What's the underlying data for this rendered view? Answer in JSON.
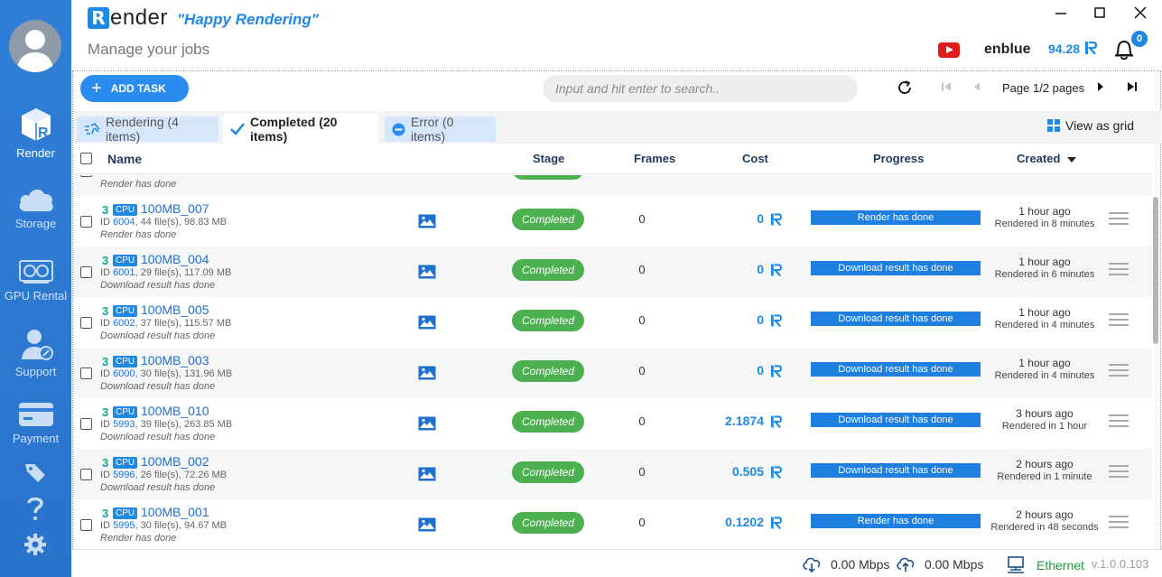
{
  "app": {
    "logo_letter": "R",
    "logo_text": "ender",
    "slogan": "\"Happy Rendering\"",
    "subtitle": "Manage your jobs"
  },
  "sidebar": {
    "items": [
      {
        "label": "Render",
        "icon": "render-cube-icon",
        "active": true
      },
      {
        "label": "Storage",
        "icon": "cloud-icon"
      },
      {
        "label": "GPU Rental",
        "icon": "gpu-card-icon"
      },
      {
        "label": "Support",
        "icon": "support-agent-icon"
      },
      {
        "label": "Payment",
        "icon": "credit-card-icon"
      }
    ],
    "bottom_icons": [
      "tag-icon",
      "help-icon",
      "gear-icon"
    ]
  },
  "user": {
    "name": "enblue",
    "balance": "94.28",
    "notifications": "0"
  },
  "toolbar": {
    "add_task_label": "ADD TASK",
    "search_placeholder": "Input and hit enter to search..",
    "page_label": "Page 1/2 pages"
  },
  "tabs": {
    "rendering": "Rendering (4 items)",
    "completed": "Completed (20 items)",
    "error": "Error (0 items)",
    "view_as_grid": "View as grid"
  },
  "table": {
    "columns": {
      "name": "Name",
      "stage": "Stage",
      "frames": "Frames",
      "cost": "Cost",
      "progress": "Progress",
      "created": "Created"
    },
    "partial_row_status": "Render has done",
    "rows": [
      {
        "cpu": "3",
        "tag": "CPU",
        "name": "100MB_007",
        "id": "6004",
        "meta": ", 44 file(s), 98.83 MB",
        "status": "Render has done",
        "stage": "Completed",
        "frames": "0",
        "cost": "0",
        "progress": "Render has done",
        "created": "1 hour ago",
        "rendered": "Rendered in 8 minutes"
      },
      {
        "cpu": "3",
        "tag": "CPU",
        "name": "100MB_004",
        "id": "6001",
        "meta": ", 29 file(s), 117.09 MB",
        "status": "Download result has done",
        "stage": "Completed",
        "frames": "0",
        "cost": "0",
        "progress": "Download result has done",
        "created": "1 hour ago",
        "rendered": "Rendered in 6 minutes"
      },
      {
        "cpu": "3",
        "tag": "CPU",
        "name": "100MB_005",
        "id": "6002",
        "meta": ", 37 file(s), 115.57 MB",
        "status": "Download result has done",
        "stage": "Completed",
        "frames": "0",
        "cost": "0",
        "progress": "Download result has done",
        "created": "1 hour ago",
        "rendered": "Rendered in 4 minutes"
      },
      {
        "cpu": "3",
        "tag": "CPU",
        "name": "100MB_003",
        "id": "6000",
        "meta": ", 30 file(s), 131.96 MB",
        "status": "Download result has done",
        "stage": "Completed",
        "frames": "0",
        "cost": "0",
        "progress": "Download result has done",
        "created": "1 hour ago",
        "rendered": "Rendered in 4 minutes"
      },
      {
        "cpu": "3",
        "tag": "CPU",
        "name": "100MB_010",
        "id": "5993",
        "meta": ", 39 file(s), 263.85 MB",
        "status": "Download result has done",
        "stage": "Completed",
        "frames": "0",
        "cost": "2.1874",
        "progress": "Download result has done",
        "created": "3 hours ago",
        "rendered": "Rendered in 1 hour"
      },
      {
        "cpu": "3",
        "tag": "CPU",
        "name": "100MB_002",
        "id": "5996",
        "meta": ", 26 file(s), 72.26 MB",
        "status": "Download result has done",
        "stage": "Completed",
        "frames": "0",
        "cost": "0.505",
        "progress": "Download result has done",
        "created": "2 hours ago",
        "rendered": "Rendered in 1 minute"
      },
      {
        "cpu": "3",
        "tag": "CPU",
        "name": "100MB_001",
        "id": "5995",
        "meta": ", 30 file(s), 94.67 MB",
        "status": "Render has done",
        "stage": "Completed",
        "frames": "0",
        "cost": "0.1202",
        "progress": "Render has done",
        "created": "2 hours ago",
        "rendered": "Rendered in 48 seconds"
      }
    ]
  },
  "statusbar": {
    "download_speed": "0.00 Mbps",
    "upload_speed": "0.00 Mbps",
    "network": "Ethernet",
    "version": "v.1.0.0.103"
  },
  "colors": {
    "sidebar": "#2f7fd8",
    "accent": "#1e88e5",
    "stage_completed": "#4caf50",
    "progress": "#1e7fe0"
  }
}
